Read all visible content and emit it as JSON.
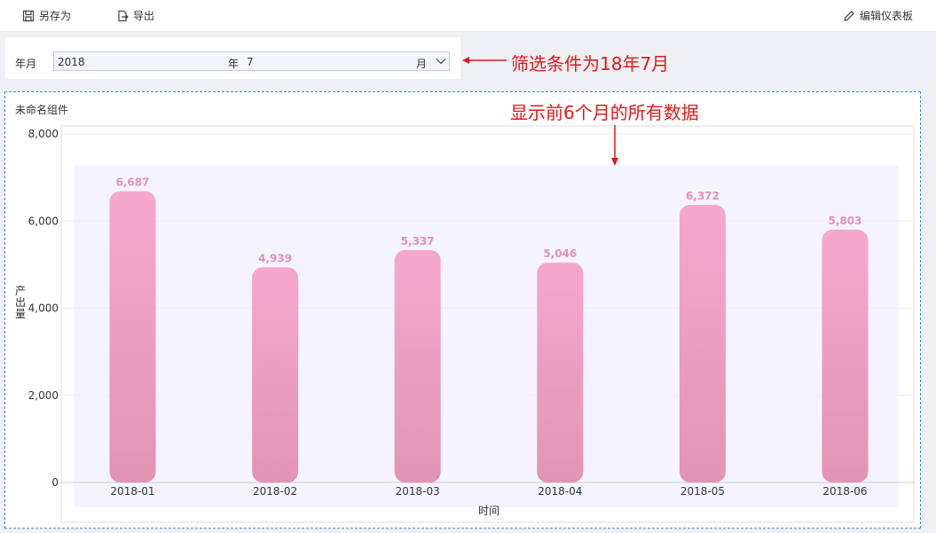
{
  "toolbar": {
    "save_as_label": "另存为",
    "export_label": "导出",
    "edit_dashboard_label": "编辑仪表板"
  },
  "filter": {
    "label": "年月",
    "year_value": "2018",
    "year_suffix": "年",
    "month_value": "7",
    "month_suffix": "月"
  },
  "annotations": {
    "filter_note": "筛选条件为18年7月",
    "chart_note": "显示前6个月的所有数据",
    "color": "#e0191b"
  },
  "widget": {
    "title": "未命名组件"
  },
  "chart_data": {
    "type": "bar",
    "categories": [
      "2018-01",
      "2018-02",
      "2018-03",
      "2018-04",
      "2018-05",
      "2018-06"
    ],
    "values": [
      6687,
      4939,
      5337,
      5046,
      6372,
      5803
    ],
    "value_labels": [
      "6,687",
      "4,939",
      "5,337",
      "5,046",
      "6,372",
      "5,803"
    ],
    "xlabel": "时间",
    "ylabel": "产出量",
    "ylim": [
      0,
      8000
    ],
    "yticks": [
      0,
      2000,
      4000,
      6000,
      8000
    ],
    "ytick_labels": [
      "0",
      "2,000",
      "4,000",
      "6,000",
      "8,000"
    ],
    "grid": true,
    "bar_color_top": "#f5a8cc",
    "bar_color_bottom": "#e194b2",
    "label_color": "#e58fb8",
    "plot_background": "#f5f4fe"
  }
}
